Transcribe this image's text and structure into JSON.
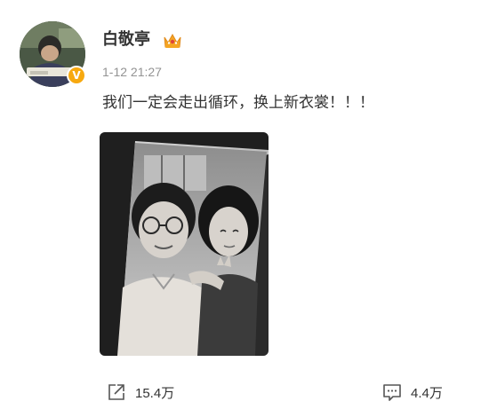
{
  "post": {
    "author": {
      "name": "白敬亭",
      "verified_badge": "V",
      "avatar": "profile-photo"
    },
    "timestamp": "1-12 21:27",
    "text": "我们一定会走出循环，换上新衣裳！！！",
    "image": "black-and-white selfie photo of two people"
  },
  "actions": {
    "share": {
      "icon": "share-icon",
      "count": "15.4万"
    },
    "comment": {
      "icon": "comment-icon",
      "count": "4.4万"
    }
  },
  "colors": {
    "badge": "#f7a90f",
    "crown": "#f5a623",
    "text": "#333333",
    "muted": "#939393"
  }
}
